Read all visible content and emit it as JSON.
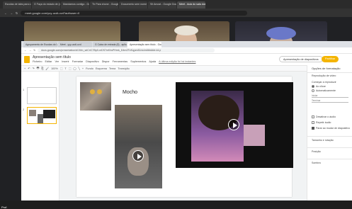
{
  "outer_browser": {
    "tabs": [
      {
        "label": "Escolas de tabs para o..."
      },
      {
        "label": "G Faça do estado de (aplicativo..."
      },
      {
        "label": "Mandamos contigo - Google S..."
      },
      {
        "label": "Tb Para shone - Google Para..."
      },
      {
        "label": "Documento sem nome - Goog..."
      },
      {
        "label": "Sit Amost - Google Docs..."
      },
      {
        "label": "Meet - Aula do sala dos..."
      }
    ],
    "url": "meet.google.com/yuy-ucdi-uvd?authuser=0"
  },
  "inner_browser": {
    "tabs": [
      {
        "label": "Agrupamento de Escolas do Vi..."
      },
      {
        "label": "Meet - yyy-ucdi-uvd"
      },
      {
        "label": "G Caixa de entrada (8) - aplicativo..."
      },
      {
        "label": "Apresentação sem título - Goo..."
      }
    ],
    "url": "docs.google.com/presentation/d/1Wo_sdCriC7Bp0-mDS7mfXwPHmk_D4mZFvKqyzn81nic/edit#slide=id.p"
  },
  "app": {
    "title": "Apresentação sem título",
    "menu": [
      "Ficheiro",
      "Editar",
      "Ver",
      "Inserir",
      "Formatar",
      "Diapositivo",
      "Dispor",
      "Ferramentas",
      "Suplementos",
      "Ajuda"
    ],
    "last_edit": "A última edição foi há instantes",
    "present_label": "Apresentação de diapositivos",
    "share_label": "Partilhar"
  },
  "toolbar": {
    "items": [
      "+",
      "↶",
      "↷",
      "🖶",
      "⎘",
      "🖌",
      "100%",
      "⬚",
      "T",
      "⬚",
      "◯",
      "╲",
      "+",
      "Fundo",
      "Esquema",
      "Tema",
      "Transição"
    ]
  },
  "filmstrip": {
    "slides": [
      {
        "number": "1"
      },
      {
        "number": "2"
      }
    ]
  },
  "slide": {
    "caption": "Mocho"
  },
  "panel": {
    "title": "Opções de formatação",
    "section_audio": "Reprodução de vídeo",
    "start_label": "Começar a reproduzir",
    "opt_click": "Ao clicar",
    "opt_auto": "Automaticamente",
    "start_at": "Iniciar",
    "end_at": "Terminar",
    "mute_label": "Desativar o áudio",
    "loop_label": "Repetir áudio",
    "stop_label": "Parar ao mudar de diapositivo",
    "section_size": "Tamanho e rotação",
    "section_pos": "Posição",
    "section_shadow": "Sombra"
  },
  "meet": {
    "tile_label": "Prof."
  },
  "colors": {
    "accent": "#f4b400",
    "meet_bg": "#202124"
  }
}
